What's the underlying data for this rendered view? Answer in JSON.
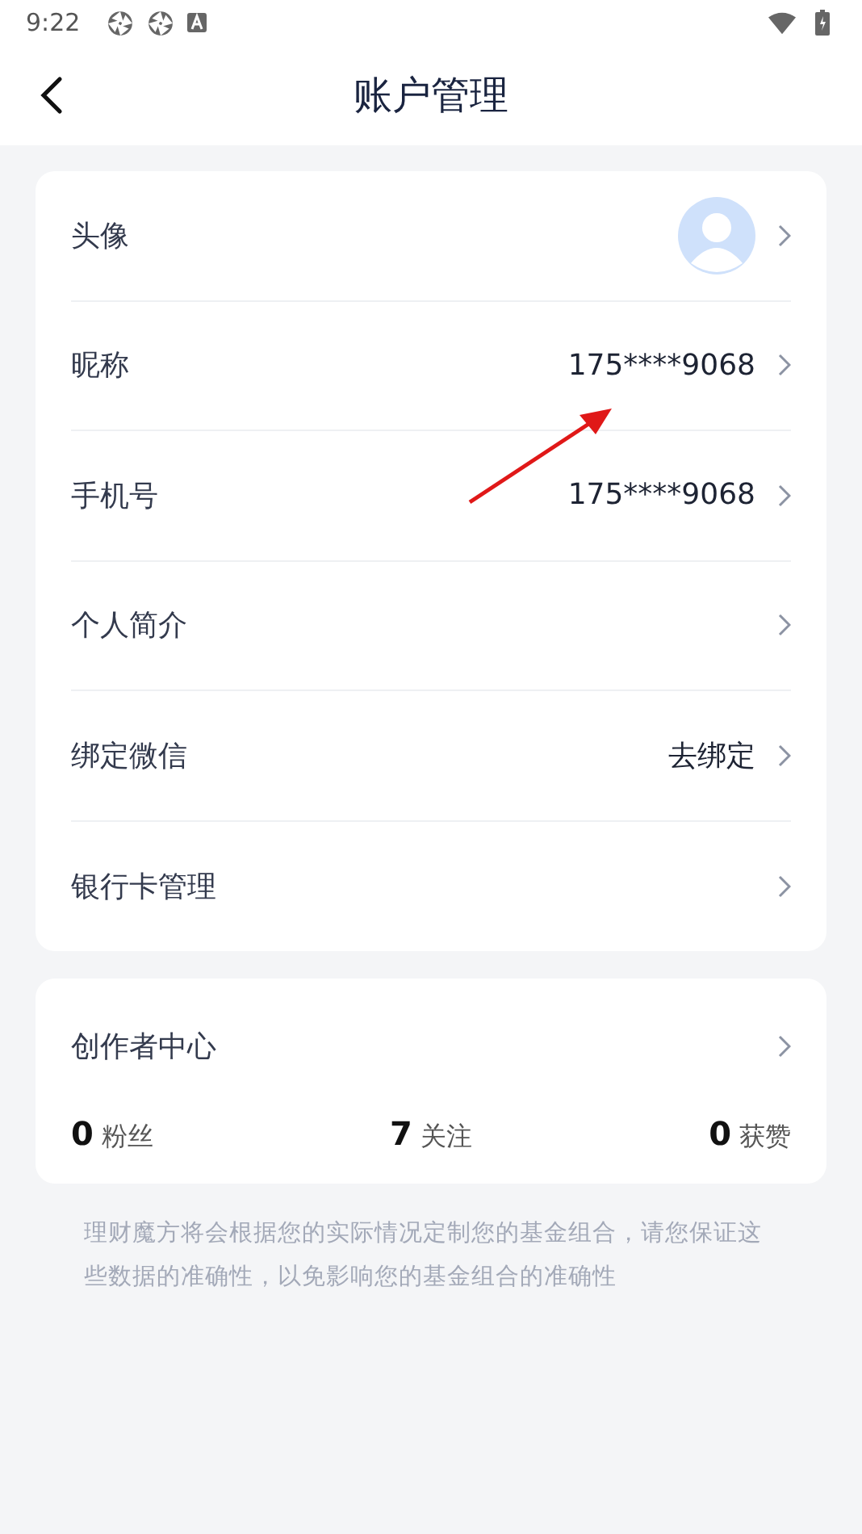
{
  "status_bar": {
    "time": "9:22"
  },
  "header": {
    "title": "账户管理"
  },
  "settings": [
    {
      "kind": "avatar",
      "label": "头像"
    },
    {
      "kind": "text",
      "label": "昵称",
      "value": "175****9068"
    },
    {
      "kind": "text",
      "label": "手机号",
      "value": "175****9068"
    },
    {
      "kind": "plain",
      "label": "个人简介"
    },
    {
      "kind": "text",
      "label": "绑定微信",
      "value": "去绑定"
    },
    {
      "kind": "plain",
      "label": "银行卡管理"
    }
  ],
  "creator": {
    "title": "创作者中心",
    "stats": [
      {
        "count": "0",
        "label": "粉丝"
      },
      {
        "count": "7",
        "label": "关注"
      },
      {
        "count": "0",
        "label": "获赞"
      }
    ]
  },
  "notice": "理财魔方将会根据您的实际情况定制您的基金组合，请您保证这些数据的准确性，以免影响您的基金组合的准确性"
}
